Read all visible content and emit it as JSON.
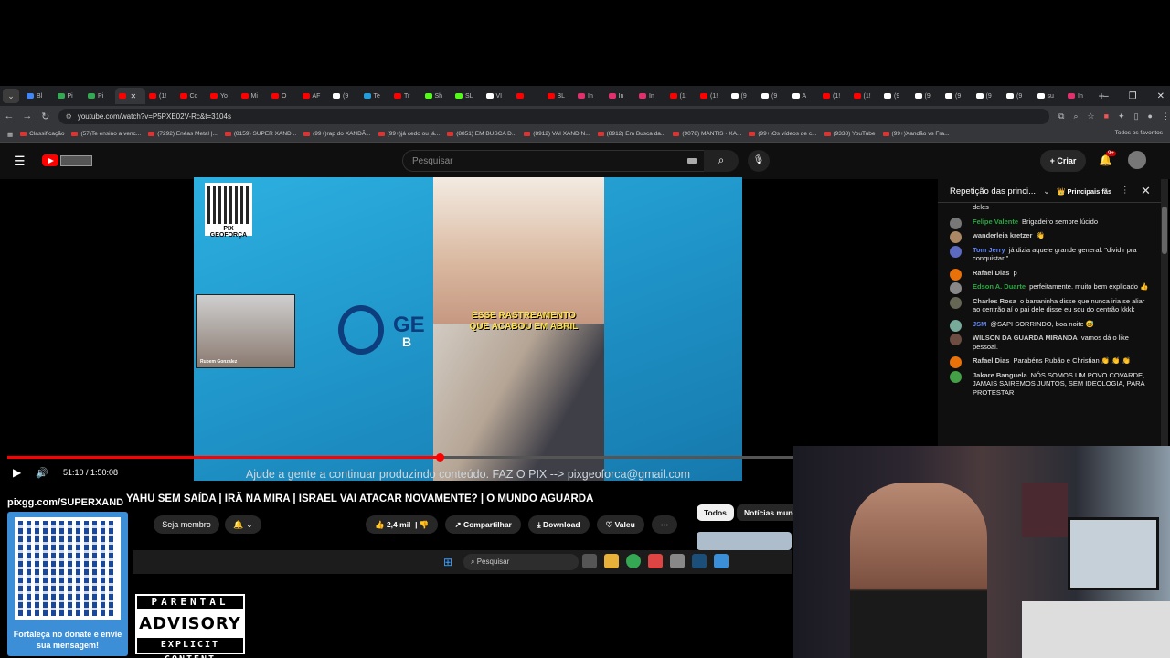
{
  "browser": {
    "tabs": [
      {
        "label": "Bl",
        "color": "#4285f4"
      },
      {
        "label": "Pi",
        "color": "#34a853"
      },
      {
        "label": "Pi",
        "color": "#34a853"
      },
      {
        "label": "",
        "color": "#ff0000",
        "active": true
      },
      {
        "label": "(1!",
        "color": "#ff0000"
      },
      {
        "label": "Co",
        "color": "#ff0000"
      },
      {
        "label": "Yo",
        "color": "#ff0000"
      },
      {
        "label": "Mi",
        "color": "#ff0000"
      },
      {
        "label": "O",
        "color": "#ff0000"
      },
      {
        "label": "AF",
        "color": "#ff0000"
      },
      {
        "label": "(9",
        "color": "#fff"
      },
      {
        "label": "Te",
        "color": "#229ed9"
      },
      {
        "label": "Tr",
        "color": "#ff0000"
      },
      {
        "label": "Sh",
        "color": "#53fc18"
      },
      {
        "label": "SL",
        "color": "#53fc18"
      },
      {
        "label": "VI",
        "color": "#ffffff"
      },
      {
        "label": "",
        "color": "#ff0000"
      },
      {
        "label": "BL",
        "color": "#ff0000"
      },
      {
        "label": "In",
        "color": "#e1306c"
      },
      {
        "label": "In",
        "color": "#e1306c"
      },
      {
        "label": "In",
        "color": "#e1306c"
      },
      {
        "label": "(1!",
        "color": "#ff0000"
      },
      {
        "label": "(1!",
        "color": "#ff0000"
      },
      {
        "label": "(9",
        "color": "#fff"
      },
      {
        "label": "(9",
        "color": "#fff"
      },
      {
        "label": "A",
        "color": "#fff"
      },
      {
        "label": "(1!",
        "color": "#ff0000"
      },
      {
        "label": "(1!",
        "color": "#ff0000"
      },
      {
        "label": "(9",
        "color": "#fff"
      },
      {
        "label": "(9",
        "color": "#fff"
      },
      {
        "label": "(9",
        "color": "#fff"
      },
      {
        "label": "(9",
        "color": "#fff"
      },
      {
        "label": "(9",
        "color": "#fff"
      },
      {
        "label": "su",
        "color": "#fff"
      },
      {
        "label": "In",
        "color": "#e1306c"
      }
    ],
    "url": "youtube.com/watch?v=P5PXE02V-Rc&t=3104s",
    "bookmarks": [
      "Classificação",
      "(57)Te ensino a venc...",
      "(7292) Enéas Metal |...",
      "(8159) SUPER XAND...",
      "(99+)rap do XANDÃ...",
      "(99+)já cedo ou já...",
      "(8851) EM BUSCA D...",
      "(8912) VAI XANDIN...",
      "(8912) Em Busca da...",
      "(9078) MANTIS · XA...",
      "(99+)Os vídeos de c...",
      "(9338) YouTube",
      "(99+)Xandão vs Fra..."
    ],
    "all_bookmarks": "Todos os favoritos"
  },
  "youtube": {
    "search_placeholder": "Pesquisar",
    "create_label": "Criar",
    "notif_count": "9+"
  },
  "video": {
    "qr_label": "PIX GEOFORÇA",
    "cam_name": "Rubem Gonzalez",
    "logo_text": "GE",
    "logo_sub": "B",
    "caption": "ESSE RASTREAMENTO QUE ACABOU EM ABRIL",
    "overlay_text": "Ajude a gente a continuar produzindo conteúdo. FAZ O PIX --> pixgeoforca@gmail.com",
    "time": "51:10 / 1:50:08",
    "progress": 0.43
  },
  "details": {
    "title": "YAHU SEM SAÍDA | IRÃ NA MIRA | ISRAEL VAI ATACAR NOVAMENTE? | O MUNDO AGUARDA",
    "join_label": "Seja membro",
    "likes": "2,4 mil",
    "share": "Compartilhar",
    "download": "Download",
    "thanks": "Valeu",
    "chip_all": "Todos",
    "chip_news": "Notícias mund"
  },
  "taskbar": {
    "search": "Pesquisar"
  },
  "chat": {
    "title": "Repetição das princi...",
    "fans_label": "Principais fãs",
    "partial_top": "deles",
    "messages": [
      {
        "author": "Felipe Valente",
        "text": "Brigadeiro sempre lúcido",
        "color": "#2ba640",
        "av": "#777"
      },
      {
        "author": "wanderleia kretzer",
        "text": "👋",
        "color": "#ccc",
        "av": "#a86"
      },
      {
        "author": "Tom Jerry",
        "text": "já dizia aquele grande general: \"dividir pra conquistar \"",
        "color": "#5e84f1",
        "av": "#5c6bc0"
      },
      {
        "author": "Rafael Dias",
        "text": "p",
        "color": "#ccc",
        "av": "#e8710a"
      },
      {
        "author": "Edson A. Duarte",
        "text": "perfeitamente. muito bem explicado 👍",
        "color": "#2ba640",
        "av": "#888"
      },
      {
        "author": "Charles Rosa",
        "text": "o bananinha disse que nunca iria se aliar ao centrão aí o pai dele disse eu sou do centrão kkkk",
        "color": "#ccc",
        "av": "#665"
      },
      {
        "author": "JSM",
        "text": "@SAPI SORRINDO, boa noite 😅",
        "color": "#5e84f1",
        "av": "#7a9"
      },
      {
        "author": "WILSON DA GUARDA MIRANDA",
        "text": "vamos dá o like pessoal.",
        "color": "#ccc",
        "av": "#6d4c41"
      },
      {
        "author": "Rafael Dias",
        "text": "Parabéns Rubão e Christian 👏 👏 👏",
        "color": "#ccc",
        "av": "#e8710a"
      },
      {
        "author": "Jakare Banguela",
        "text": "NÓS SOMOS UM POVO COVARDE, JAMAIS SAIREMOS JUNTOS, SEM IDEOLOGIA, PARA PROTESTAR",
        "color": "#ccc",
        "av": "#43a047"
      }
    ]
  },
  "overlays": {
    "pix_banner": "pixgg.com/SUPERXAND",
    "donate_caption": "Fortaleça no donate e envie sua mensagem!",
    "advisory_1": "PARENTAL",
    "advisory_2": "ADVISORY",
    "advisory_3": "EXPLICIT CONTENT"
  }
}
